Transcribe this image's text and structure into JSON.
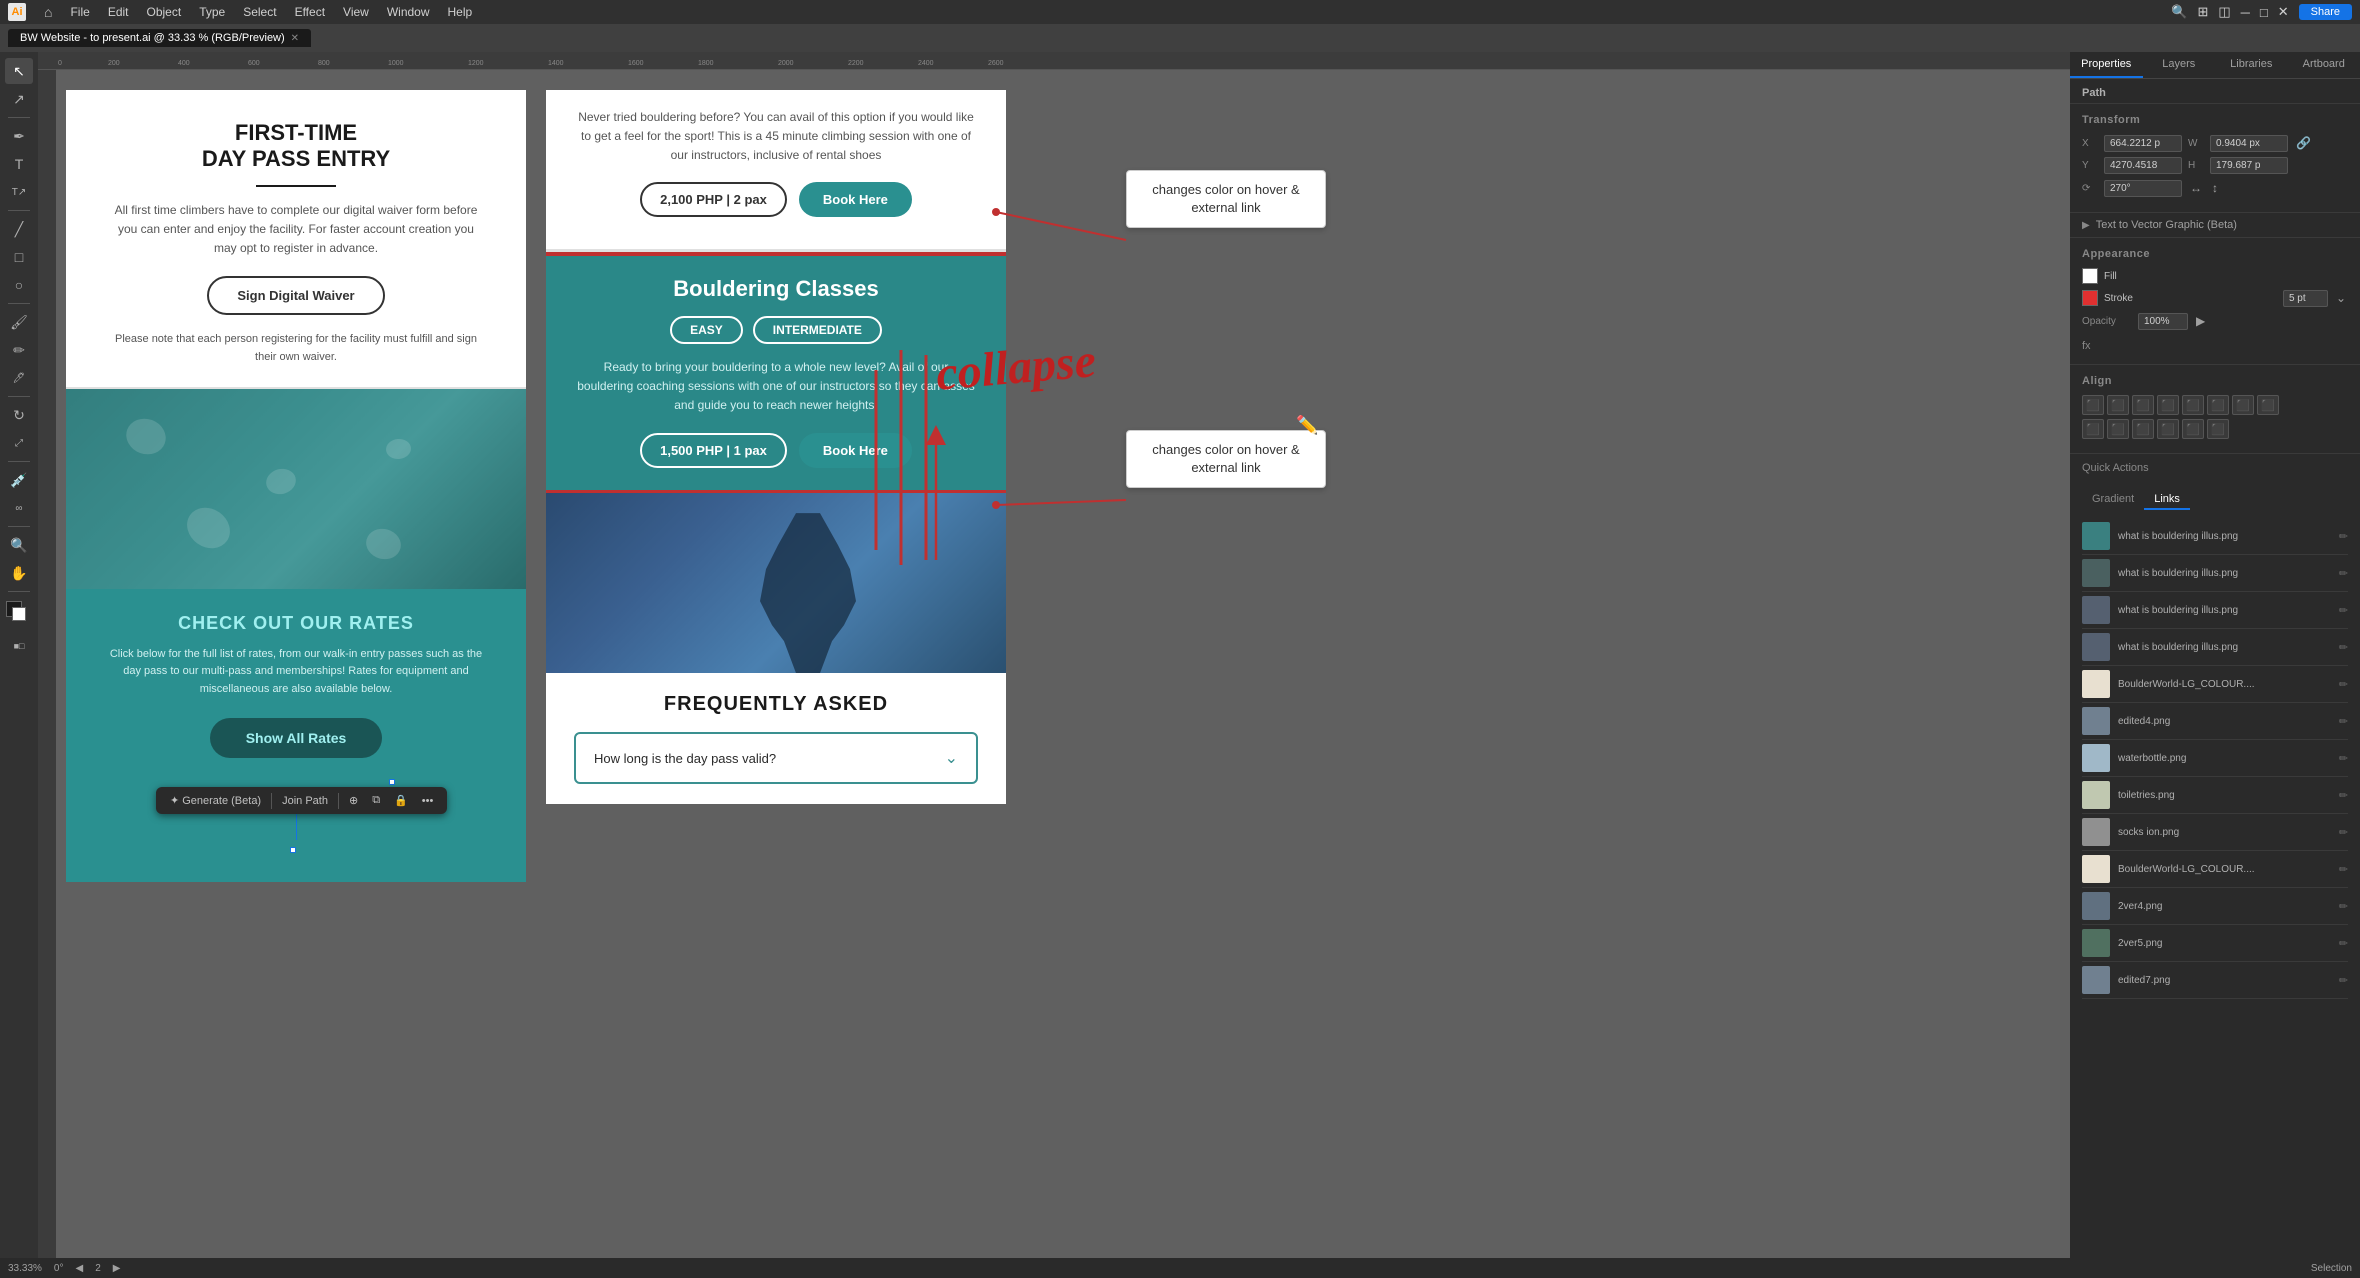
{
  "app": {
    "title": "BW Website - to present.ai @ 33.33 % (RGB/Preview)",
    "share_label": "Share"
  },
  "menu": {
    "items": [
      "File",
      "Edit",
      "Object",
      "Type",
      "Select",
      "Effect",
      "View",
      "Window",
      "Help"
    ],
    "logo_icon": "ai"
  },
  "tabs": {
    "items": [
      {
        "label": "BW Website - to present.ai @ 33.33 % (RGB/Preview)",
        "active": true
      }
    ]
  },
  "panel": {
    "tabs": [
      "Properties",
      "Layers",
      "Libraries",
      "Artboard"
    ],
    "active_tab": "Properties",
    "path_label": "Path",
    "transform": {
      "x_label": "X",
      "x_value": "664.2212 p",
      "y_label": "Y",
      "y_value": "4270.4518",
      "w_label": "W",
      "w_value": "0.9404 px",
      "h_label": "H",
      "h_value": "179.687 p"
    },
    "rotation_label": "270°",
    "text_vector_label": "Text to Vector Graphic (Beta)",
    "appearance": {
      "label": "Appearance",
      "fill_label": "Fill",
      "stroke_label": "Stroke",
      "stroke_size": "5 pt",
      "opacity_label": "Opacity",
      "opacity_value": "100%",
      "fx_label": "fx"
    },
    "align_label": "Align",
    "quick_actions_label": "Quick Actions",
    "links_tabs": [
      "Gradient",
      "Links"
    ],
    "active_links_tab": "Links",
    "links_items": [
      {
        "name": "what is bouldering illus.png"
      },
      {
        "name": "what is bouldering illus.png"
      },
      {
        "name": "what is bouldering illus.png"
      },
      {
        "name": "what is bouldering illus.png"
      },
      {
        "name": "BoulderWorld-LG_COLOUR...."
      },
      {
        "name": "edited4.png"
      },
      {
        "name": "waterbottle.png"
      },
      {
        "name": "toiletries.png"
      },
      {
        "name": "socks ion.png"
      },
      {
        "name": "BoulderWorld-LG_COLOUR...."
      },
      {
        "name": "2ver4.png"
      },
      {
        "name": "2ver5.png"
      },
      {
        "name": "edited7.png"
      }
    ]
  },
  "canvas": {
    "zoom_level": "33.33%",
    "rotation": "0°",
    "artboard": "2"
  },
  "left_panel": {
    "first_time": {
      "title_line1": "FIRST-TIME",
      "title_line2": "DAY PASS ENTRY",
      "body": "All first time climbers have to complete our digital waiver form before you can enter and enjoy the facility. For faster account creation you may opt to register in advance.",
      "btn_label": "Sign Digital Waiver",
      "note": "Please note that each person registering for the facility must fulfill and sign their own waiver."
    },
    "rates": {
      "title": "CHECK OUT OUR RATES",
      "body": "Click below for the full list of rates, from our walk-in entry passes such as the day pass to our multi-pass and memberships! Rates for equipment and miscellaneous are also available below.",
      "btn_label": "Show All Rates"
    }
  },
  "right_panel": {
    "pricing_top": {
      "desc": "Never tried bouldering before? You can avail of this option if you would like to get a feel for the sport! This is a 45 minute climbing session with one of our instructors, inclusive of rental shoes",
      "price": "2,100 PHP | 2 pax",
      "book_btn": "Book Here"
    },
    "bouldering_classes": {
      "title": "Bouldering Classes",
      "badges": [
        "EASY",
        "INTERMEDIATE"
      ],
      "desc": "Ready to bring your bouldering to a whole new level? Avail of our bouldering coaching sessions with one of our instructors so they can asses and guide you to reach newer heights!",
      "price": "1,500 PHP | 1 pax",
      "book_btn": "Book Here"
    },
    "faq": {
      "title": "FREQUENTLY ASKED",
      "question": "How long is the day pass valid?"
    }
  },
  "annotations": {
    "box1_text": "changes color on\nhover & external link",
    "box2_text": "changes color on\nhover & external link",
    "collapse_text": "collapse"
  },
  "floating_toolbar": {
    "generate_label": "Generate (Beta)",
    "join_path_label": "Join Path"
  },
  "status_bar": {
    "zoom": "33.33%",
    "rotation": "0°",
    "artboard": "2",
    "selection_label": "Selection"
  }
}
